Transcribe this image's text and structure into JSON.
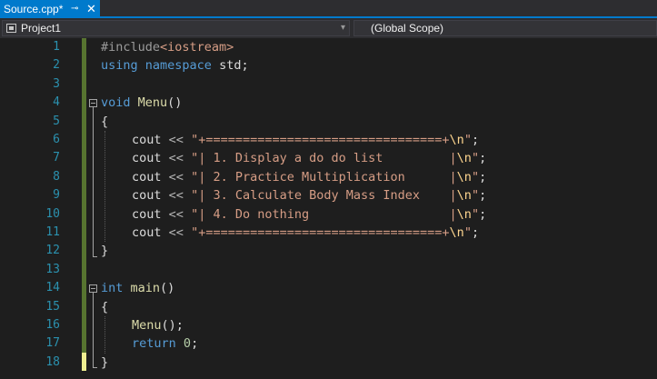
{
  "tab": {
    "title": "Source.cpp*",
    "pin_glyph": "⊸",
    "close_glyph": "✕"
  },
  "navbar": {
    "project": "Project1",
    "scope": "(Global Scope)"
  },
  "line_numbers": [
    "1",
    "2",
    "3",
    "4",
    "5",
    "6",
    "7",
    "8",
    "9",
    "10",
    "11",
    "12",
    "13",
    "14",
    "15",
    "16",
    "17",
    "18"
  ],
  "code": {
    "l1": {
      "pp": "#include",
      "inc": "<iostream>"
    },
    "l2": {
      "kw1": "using",
      "kw2": "namespace",
      "id": "std;"
    },
    "l4": {
      "kw": "void",
      "fn": "Menu",
      "rest": "()"
    },
    "l5": {
      "text": "{"
    },
    "l6": {
      "id": "cout",
      "op": "<<",
      "str": "\"+================================+",
      "esc": "\\n",
      "end": "\"",
      ";": ";"
    },
    "l7": {
      "id": "cout",
      "op": "<<",
      "str": "\"| 1. Display a do do list         |",
      "esc": "\\n",
      "end": "\""
    },
    "l8": {
      "id": "cout",
      "op": "<<",
      "str": "\"| 2. Practice Multiplication      |",
      "esc": "\\n",
      "end": "\""
    },
    "l9": {
      "id": "cout",
      "op": "<<",
      "str": "\"| 3. Calculate Body Mass Index    |",
      "esc": "\\n",
      "end": "\""
    },
    "l10": {
      "id": "cout",
      "op": "<<",
      "str": "\"| 4. Do nothing                   |",
      "esc": "\\n",
      "end": "\""
    },
    "l11": {
      "id": "cout",
      "op": "<<",
      "str": "\"+================================+",
      "esc": "\\n",
      "end": "\""
    },
    "l12": {
      "text": "}"
    },
    "l14": {
      "kw": "int",
      "fn": "main",
      "rest": "()"
    },
    "l15": {
      "text": "{"
    },
    "l16": {
      "fn": "Menu",
      "rest": "();"
    },
    "l17": {
      "kw": "return",
      "num": "0",
      "rest": ";"
    },
    "l18": {
      "text": "}"
    }
  },
  "colors": {
    "accent": "#007acc",
    "editor_bg": "#1e1e1e",
    "line_number": "#2b91af",
    "keyword": "#569cd6",
    "string": "#d69d85",
    "function": "#dcdcaa",
    "escape": "#ffd68f",
    "number": "#b5cea8",
    "changed_saved": "#577430",
    "changed_unsaved": "#efef91"
  }
}
